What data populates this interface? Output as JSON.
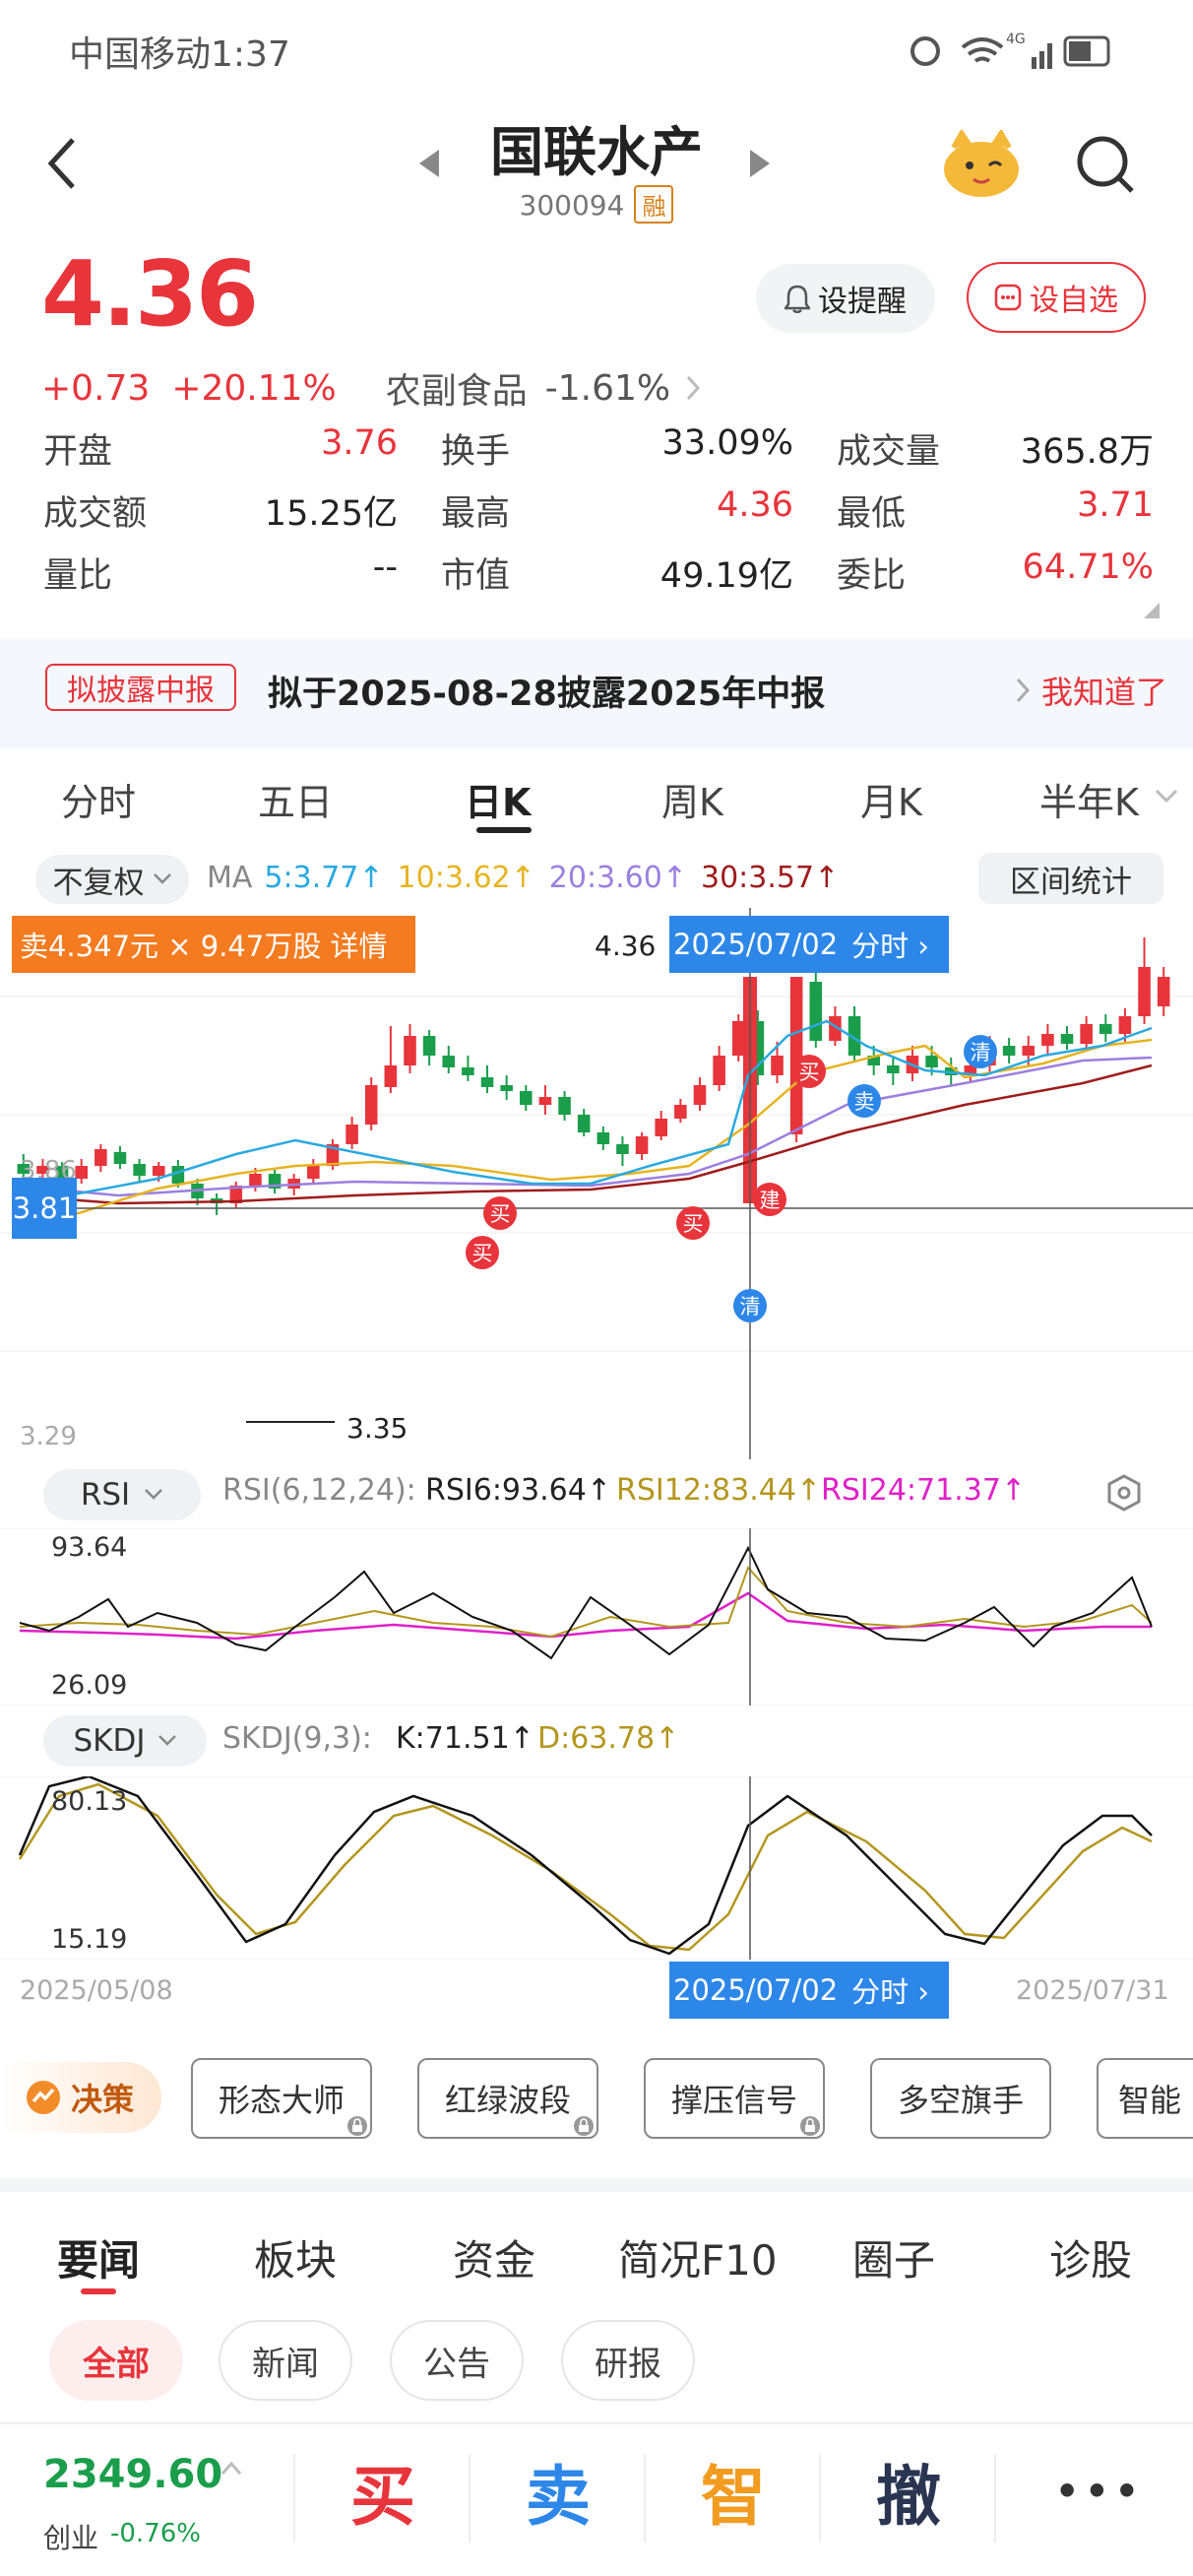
{
  "status": {
    "carrier_time": "中国移动1:37",
    "network": "4G"
  },
  "header": {
    "name": "国联水产",
    "code": "300094",
    "margin_tag": "融"
  },
  "quote": {
    "price": "4.36",
    "change": "+0.73",
    "change_pct": "+20.11%",
    "sector": "农副食品",
    "sector_pct": "-1.61%",
    "alert_label": "设提醒",
    "watch_label": "设自选"
  },
  "stats": [
    {
      "label": "开盘",
      "value": "3.76",
      "color": "#e8343b"
    },
    {
      "label": "换手",
      "value": "33.09%",
      "color": "#222222"
    },
    {
      "label": "成交量",
      "value": "365.8万",
      "color": "#222222"
    },
    {
      "label": "成交额",
      "value": "15.25亿",
      "color": "#222222"
    },
    {
      "label": "最高",
      "value": "4.36",
      "color": "#e8343b"
    },
    {
      "label": "最低",
      "value": "3.71",
      "color": "#e8343b"
    },
    {
      "label": "量比",
      "value": "--",
      "color": "#222222"
    },
    {
      "label": "市值",
      "value": "49.19亿",
      "color": "#222222"
    },
    {
      "label": "委比",
      "value": "64.71%",
      "color": "#e8343b"
    }
  ],
  "notice": {
    "tag": "拟披露中报",
    "text": "拟于2025-08-28披露2025年中报",
    "action": "我知道了"
  },
  "tabs": [
    "分时",
    "五日",
    "日K",
    "周K",
    "月K",
    "半年K"
  ],
  "chart_bar": {
    "adjust": "不复权",
    "ma_label": "MA",
    "ma5": "5:3.77↑",
    "ma10": "10:3.62↑",
    "ma20": "20:3.60↑",
    "ma30": "30:3.57↑",
    "range_stats": "区间统计"
  },
  "chart_overlay": {
    "sell_info": "卖4.347元 × 9.47万股 详情",
    "high_label": "4.36",
    "date_box": "2025/07/02",
    "fenshi": "分时 ›",
    "cursor_price": "3.81",
    "low_label": "3.35",
    "axis_top": "3.86",
    "axis_bottom": "3.29",
    "signals": {
      "buy": "买",
      "sell": "卖",
      "clear": "清",
      "build": "建"
    }
  },
  "rsi": {
    "chip": "RSI",
    "params": "RSI(6,12,24):",
    "rsi6": "RSI6:93.64↑",
    "rsi12": "RSI12:83.44↑",
    "rsi24": "RSI24:71.37↑",
    "top": "93.64",
    "bottom": "26.09"
  },
  "skdj": {
    "chip": "SKDJ",
    "params": "SKDJ(9,3):",
    "k": "K:71.51↑",
    "d": "D:63.78↑",
    "top": "80.13",
    "bottom": "15.19"
  },
  "dates": {
    "start": "2025/05/08",
    "cursor": "2025/07/02",
    "end": "2025/07/31",
    "cursor_action": "分时 ›"
  },
  "tools": {
    "decision": "决策",
    "items": [
      "形态大师",
      "红绿波段",
      "撑压信号",
      "多空旗手",
      "智能"
    ]
  },
  "news_tabs": [
    "要闻",
    "板块",
    "资金",
    "简况F10",
    "圈子",
    "诊股"
  ],
  "news_subtabs": [
    "全部",
    "新闻",
    "公告",
    "研报"
  ],
  "bottom_bar": {
    "index_value": "2349.60",
    "index_name": "创业",
    "index_pct": "-0.76%",
    "buy": "买",
    "sell": "卖",
    "smart": "智",
    "cancel": "撤",
    "more": "•••"
  },
  "colors": {
    "up": "#e8343b",
    "down": "#1a9e4b",
    "ma5": "#2aa9e0",
    "ma10": "#e6b422",
    "ma20": "#9b7fe0",
    "ma30": "#a01c1c",
    "accent": "#2d87e8"
  },
  "chart_data": {
    "type": "candlestick",
    "x_start": "2025/05/08",
    "x_end": "2025/07/31",
    "y_range": [
      3.29,
      4.36
    ],
    "last_close": 4.36,
    "cursor_date": "2025/07/02",
    "cursor_price": 3.81,
    "low_marked": 3.35,
    "ma": [
      {
        "name": "MA5",
        "value": 3.77
      },
      {
        "name": "MA10",
        "value": 3.62
      },
      {
        "name": "MA20",
        "value": 3.6
      },
      {
        "name": "MA30",
        "value": 3.57
      }
    ],
    "rsi": {
      "rsi6": 93.64,
      "rsi12": 83.44,
      "rsi24": 71.37,
      "range": [
        26.09,
        93.64
      ]
    },
    "skdj": {
      "k": 71.51,
      "d": 63.78,
      "range": [
        15.19,
        80.13
      ]
    }
  }
}
